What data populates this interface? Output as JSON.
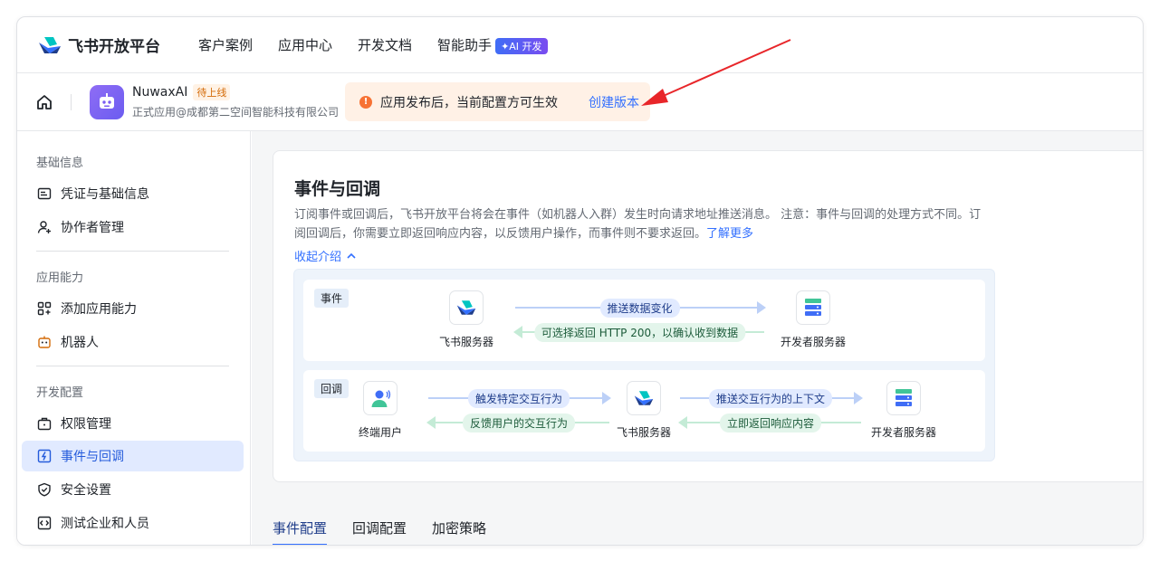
{
  "topnav": {
    "brand": "飞书开放平台",
    "items": [
      "客户案例",
      "应用中心",
      "开发文档",
      "智能助手"
    ],
    "ai_badge": "✦AI 开发"
  },
  "appbar": {
    "app_name": "NuwaxAI",
    "status": "待上线",
    "org": "正式应用@成都第二空间智能科技有限公司",
    "notice_icon": "!",
    "notice": "应用发布后，当前配置方可生效",
    "notice_action": "创建版本"
  },
  "sidebar": {
    "groups": [
      {
        "title": "基础信息",
        "items": [
          {
            "label": "凭证与基础信息",
            "icon": "id-card-icon"
          },
          {
            "label": "协作者管理",
            "icon": "user-add-icon"
          }
        ]
      },
      {
        "title": "应用能力",
        "items": [
          {
            "label": "添加应用能力",
            "icon": "apps-add-icon"
          },
          {
            "label": "机器人",
            "icon": "robot-icon"
          }
        ]
      },
      {
        "title": "开发配置",
        "items": [
          {
            "label": "权限管理",
            "icon": "briefcase-icon"
          },
          {
            "label": "事件与回调",
            "icon": "event-icon"
          },
          {
            "label": "安全设置",
            "icon": "shield-icon"
          },
          {
            "label": "测试企业和人员",
            "icon": "code-icon"
          }
        ]
      }
    ],
    "active": "事件与回调"
  },
  "main": {
    "title": "事件与回调",
    "desc": "订阅事件或回调后，飞书开放平台将会在事件（如机器人入群）发生时向请求地址推送消息。 注意：事件与回调的处理方式不同。订阅回调后，你需要立即返回响应内容，以反馈用户操作，而事件则不要求返回。",
    "learn_more": "了解更多",
    "collapse": "收起介绍",
    "event_lane": {
      "tag": "事件",
      "source": "飞书服务器",
      "target": "开发者服务器",
      "push": "推送数据变化",
      "reply": "可选择返回 HTTP 200，以确认收到数据"
    },
    "callback_lane": {
      "tag": "回调",
      "user": "终端用户",
      "server": "飞书服务器",
      "dev": "开发者服务器",
      "trigger": "触发特定交互行为",
      "feedback": "反馈用户的交互行为",
      "push_ctx": "推送交互行为的上下文",
      "respond": "立即返回响应内容"
    },
    "tabs": [
      "事件配置",
      "回调配置",
      "加密策略"
    ],
    "active_tab": "事件配置"
  },
  "colors": {
    "primary": "#3370ff",
    "annotation_arrow": "#e8262a",
    "warning": "#f77234"
  }
}
